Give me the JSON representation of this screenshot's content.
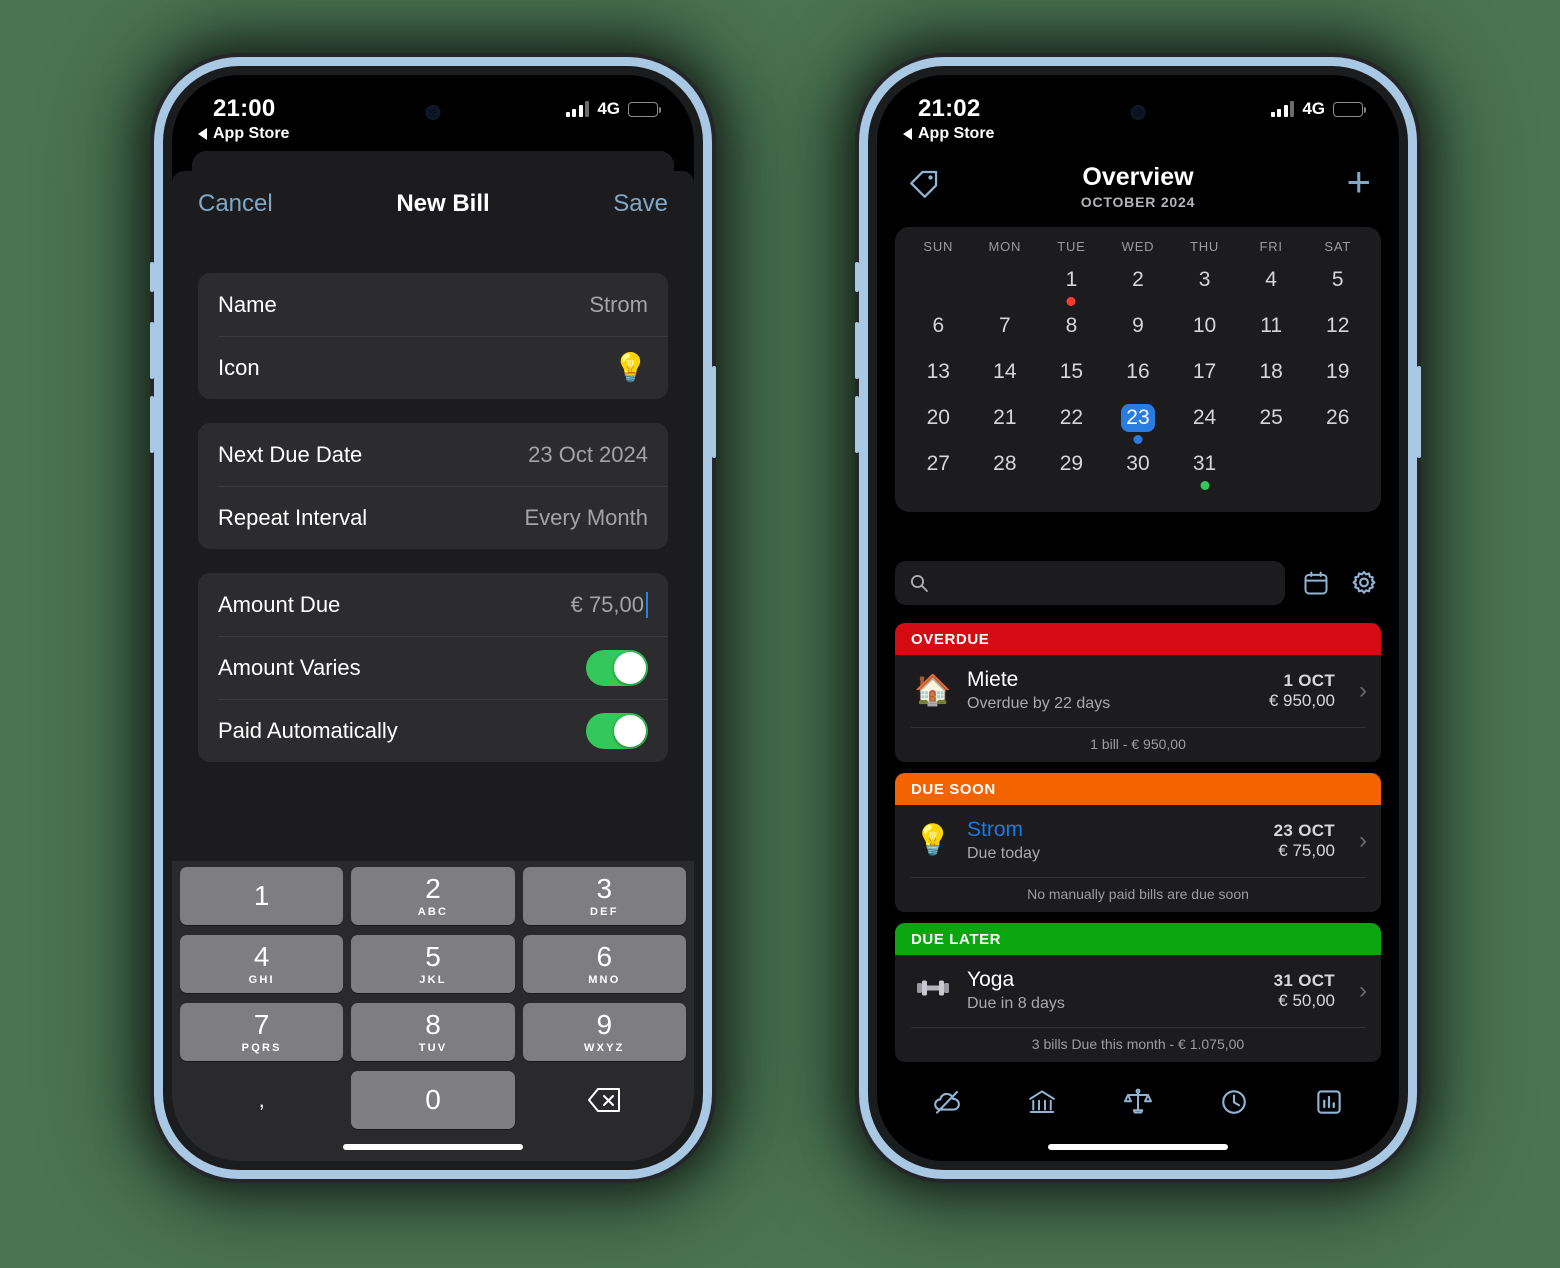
{
  "left_phone": {
    "status": {
      "time": "21:00",
      "back_label": "App Store",
      "network": "4G"
    },
    "sheet": {
      "cancel_label": "Cancel",
      "title": "New Bill",
      "save_label": "Save",
      "groups": [
        {
          "rows": [
            {
              "label": "Name",
              "value": "Strom",
              "type": "text"
            },
            {
              "label": "Icon",
              "value": "💡",
              "type": "emoji"
            }
          ]
        },
        {
          "rows": [
            {
              "label": "Next Due Date",
              "value": "23 Oct 2024",
              "type": "text"
            },
            {
              "label": "Repeat Interval",
              "value": "Every Month",
              "type": "text"
            }
          ]
        },
        {
          "rows": [
            {
              "label": "Amount Due",
              "value": "€ 75,00",
              "type": "amount"
            },
            {
              "label": "Amount Varies",
              "value": "on",
              "type": "toggle"
            },
            {
              "label": "Paid Automatically",
              "value": "on",
              "type": "toggle"
            }
          ]
        }
      ]
    },
    "keypad": {
      "keys": [
        {
          "num": "1",
          "sub": ""
        },
        {
          "num": "2",
          "sub": "ABC"
        },
        {
          "num": "3",
          "sub": "DEF"
        },
        {
          "num": "4",
          "sub": "GHI"
        },
        {
          "num": "5",
          "sub": "JKL"
        },
        {
          "num": "6",
          "sub": "MNO"
        },
        {
          "num": "7",
          "sub": "PQRS"
        },
        {
          "num": "8",
          "sub": "TUV"
        },
        {
          "num": "9",
          "sub": "WXYZ"
        },
        {
          "num": ",",
          "sub": ""
        },
        {
          "num": "0",
          "sub": ""
        },
        {
          "num": "delete-icon",
          "sub": ""
        }
      ]
    }
  },
  "right_phone": {
    "status": {
      "time": "21:02",
      "back_label": "App Store",
      "network": "4G"
    },
    "header": {
      "title": "Overview",
      "subtitle": "OCTOBER 2024",
      "tag_icon": "tag-icon",
      "add_icon": "plus-icon"
    },
    "calendar": {
      "weekdays": [
        "SUN",
        "MON",
        "TUE",
        "WED",
        "THU",
        "FRI",
        "SAT"
      ],
      "weeks": [
        [
          {
            "day": ""
          },
          {
            "day": ""
          },
          {
            "day": "1",
            "dot": "red"
          },
          {
            "day": "2"
          },
          {
            "day": "3"
          },
          {
            "day": "4"
          },
          {
            "day": "5"
          }
        ],
        [
          {
            "day": "6"
          },
          {
            "day": "7"
          },
          {
            "day": "8"
          },
          {
            "day": "9"
          },
          {
            "day": "10"
          },
          {
            "day": "11"
          },
          {
            "day": "12"
          }
        ],
        [
          {
            "day": "13"
          },
          {
            "day": "14"
          },
          {
            "day": "15"
          },
          {
            "day": "16"
          },
          {
            "day": "17"
          },
          {
            "day": "18"
          },
          {
            "day": "19"
          }
        ],
        [
          {
            "day": "20"
          },
          {
            "day": "21"
          },
          {
            "day": "22"
          },
          {
            "day": "23",
            "today": true,
            "dot": "blue"
          },
          {
            "day": "24"
          },
          {
            "day": "25"
          },
          {
            "day": "26"
          }
        ],
        [
          {
            "day": "27"
          },
          {
            "day": "28"
          },
          {
            "day": "29"
          },
          {
            "day": "30"
          },
          {
            "day": "31",
            "dot": "green"
          },
          {
            "day": ""
          },
          {
            "day": ""
          }
        ]
      ],
      "colors": {
        "today": "#2a7ce0",
        "overdue_dot": "#ff3b30",
        "later_dot": "#34c759"
      }
    },
    "search": {
      "value": "",
      "placeholder": "",
      "icon": "search-icon"
    },
    "toolbar": {
      "calendar_icon": "calendar-icon",
      "settings_icon": "gear-icon"
    },
    "sections": [
      {
        "heading": "OVERDUE",
        "color": "#d40b13",
        "bills": [
          {
            "icon": "🏠",
            "name": "Miete",
            "sub": "Overdue by 22 days",
            "date": "1 OCT",
            "amount": "€ 950,00",
            "highlight": false
          }
        ],
        "footer": "1 bill - € 950,00"
      },
      {
        "heading": "DUE SOON",
        "color": "#f56300",
        "bills": [
          {
            "icon": "💡",
            "name": "Strom",
            "sub": "Due today",
            "date": "23 OCT",
            "amount": "€ 75,00",
            "highlight": true
          }
        ],
        "footer": "No manually paid bills are due soon"
      },
      {
        "heading": "DUE LATER",
        "color": "#0aa50f",
        "bills": [
          {
            "icon": "🏋",
            "name": "Yoga",
            "sub": "Due in 8 days",
            "date": "31 OCT",
            "amount": "€ 50,00",
            "highlight": false
          }
        ],
        "footer": "3 bills Due this month - € 1.075,00"
      }
    ],
    "tabbar": {
      "items": [
        {
          "icon": "cloud-slash-icon",
          "active": false
        },
        {
          "icon": "bank-icon",
          "active": false
        },
        {
          "icon": "scales-icon",
          "active": true
        },
        {
          "icon": "clock-icon",
          "active": false
        },
        {
          "icon": "chart-icon",
          "active": false
        }
      ]
    }
  }
}
